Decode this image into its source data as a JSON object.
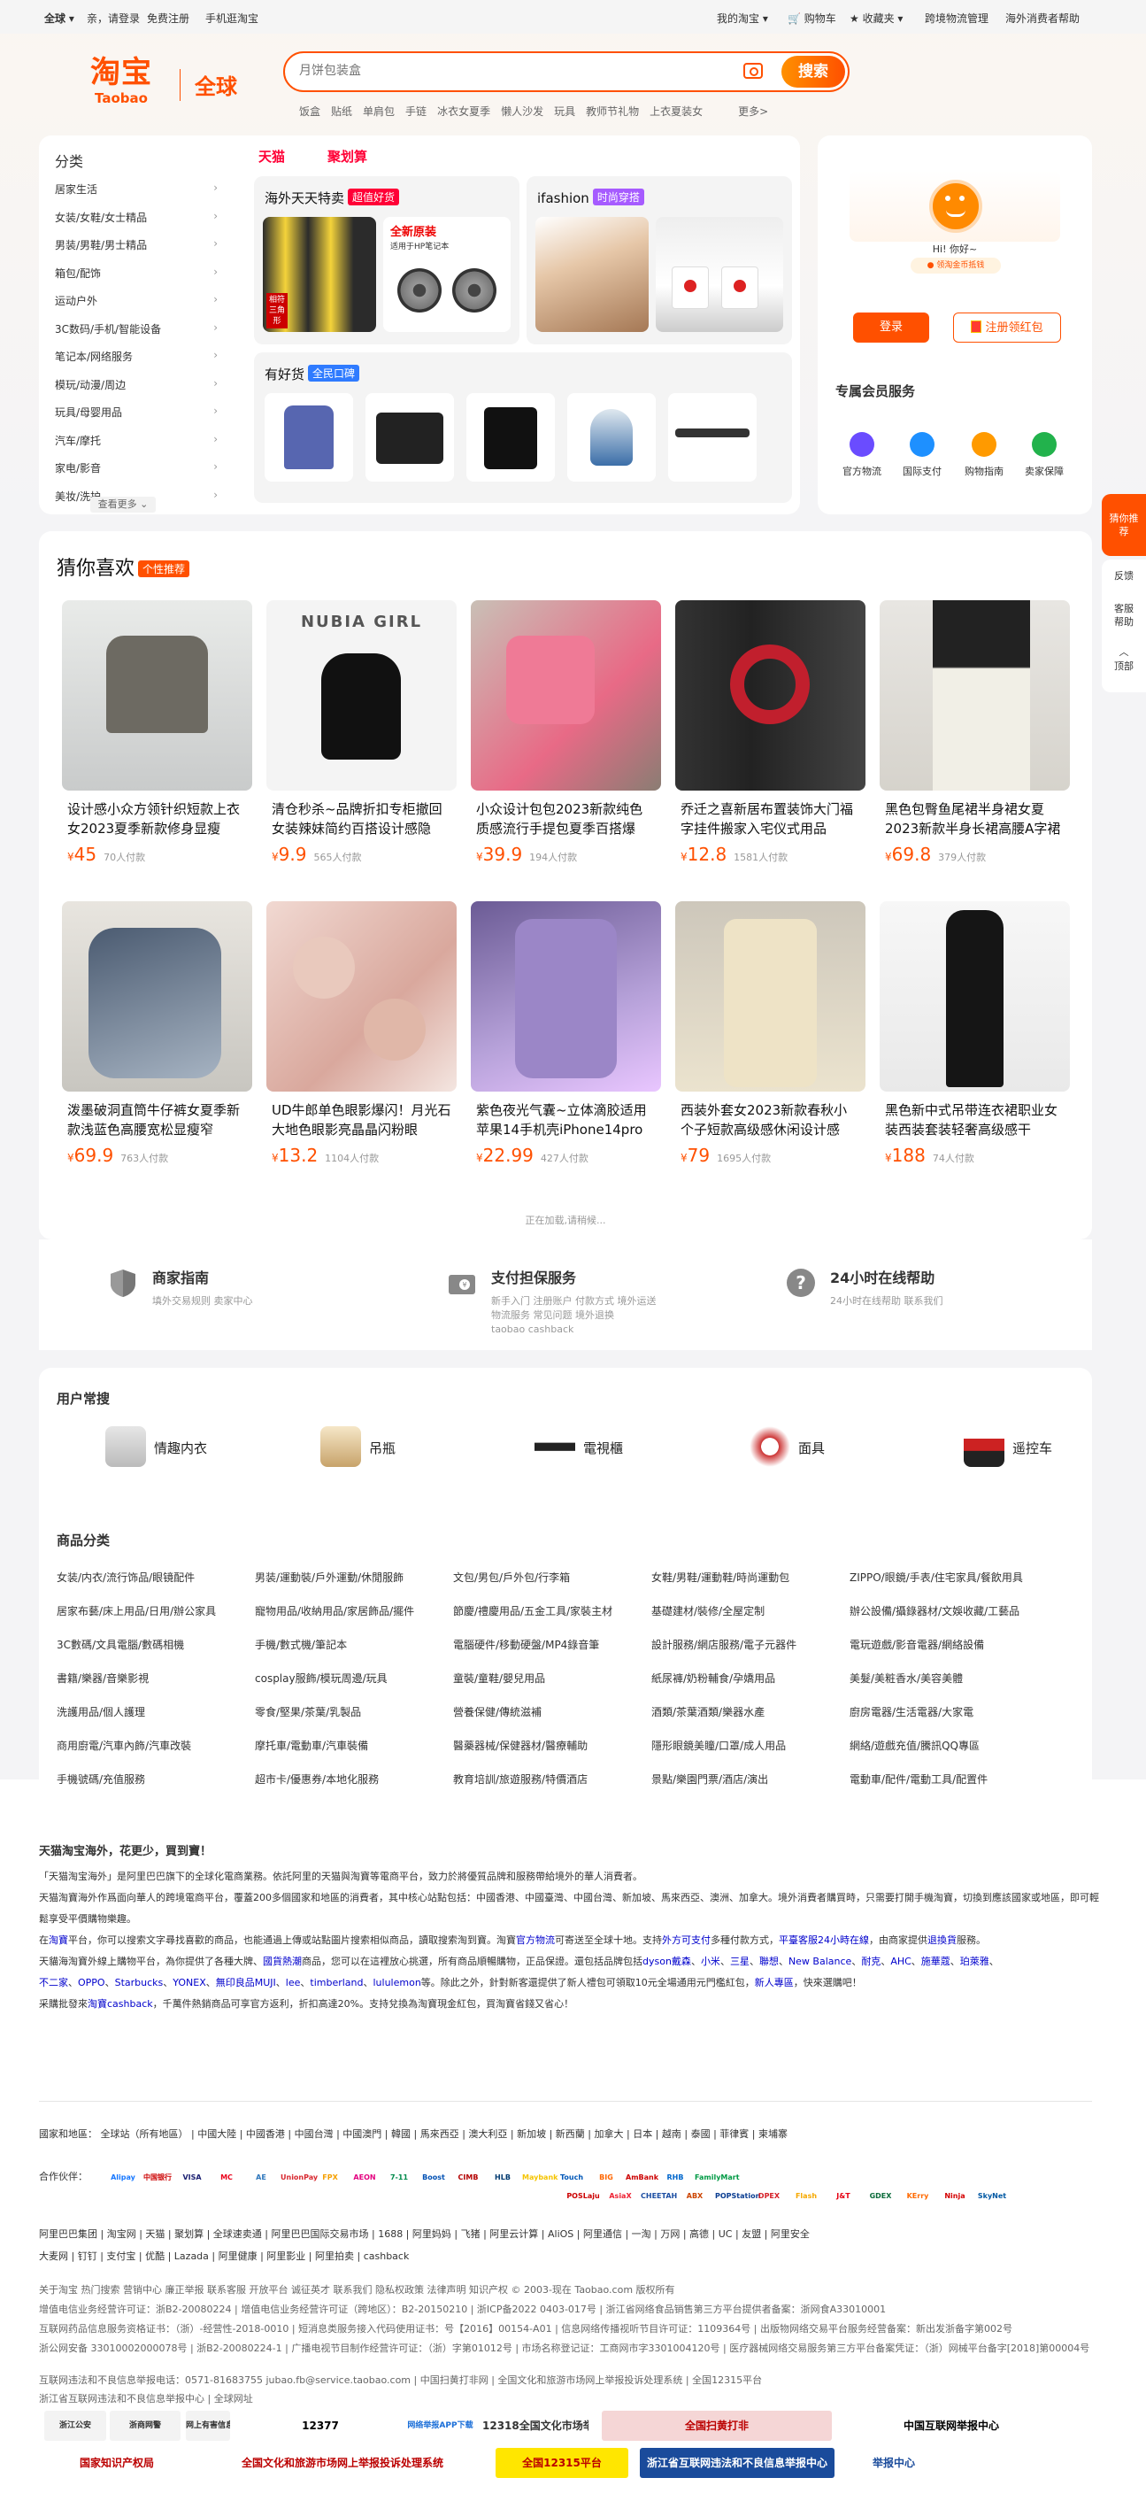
{
  "topbar": {
    "region": "全球",
    "greet": "亲，请登录",
    "register": "免费注册",
    "mobile": "手机逛淘宝",
    "mytaobao": "我的淘宝",
    "cart": "购物车",
    "favorites": "收藏夹",
    "crossborder": "跨境物流管理",
    "help": "海外消费者帮助"
  },
  "logo": {
    "cn": "淘宝",
    "en": "Taobao",
    "global": "全球"
  },
  "search": {
    "placeholder": "月饼包装盒",
    "button": "搜索",
    "hot": [
      "饭盒",
      "贴纸",
      "单肩包",
      "手链",
      "冰衣女夏季",
      "懒人沙发",
      "玩具",
      "教师节礼物",
      "上衣夏装女",
      "更多>"
    ]
  },
  "categories": {
    "title": "分类",
    "items": [
      "居家生活",
      "女装/女鞋/女士精品",
      "男装/男鞋/男士精品",
      "箱包/配饰",
      "运动户外",
      "3C数码/手机/智能设备",
      "笔记本/网络服务",
      "模玩/动漫/周边",
      "玩具/母婴用品",
      "汽车/摩托",
      "家电/影音",
      "美妆/洗护"
    ],
    "more": "查看更多"
  },
  "promo": {
    "tab1": "天猫",
    "tab2": "聚划算",
    "box1_title": "海外天天特卖",
    "box1_badge": "超值好货",
    "box1_img_text": "全新原装",
    "box1_img_sub": "适用于HP笔记本",
    "box1_img_side": "相符 三角形",
    "box2_title": "ifashion",
    "box2_badge": "时尚穿搭",
    "box3_title": "有好货",
    "box3_badge": "全民口碑"
  },
  "user": {
    "hello": "Hi! 你好~",
    "coin": "领淘金币抵钱",
    "login": "登录",
    "coupon": "注册领红包",
    "services_title": "专属会员服务",
    "services": [
      "官方物流",
      "国际支付",
      "购物指南",
      "卖家保障"
    ]
  },
  "sidefloat": {
    "recommend": "猜你推荐",
    "feedback": "反馈",
    "service": "客服帮助",
    "top": "顶部"
  },
  "guess": {
    "title": "猜你喜欢",
    "badge": "个性推荐",
    "loading": "正在加载,请稍候...",
    "products": [
      {
        "name": "设计感小众方领针织短款上衣女2023夏季新款修身显瘦",
        "price": "45",
        "sold": "70人付款"
      },
      {
        "name": "清仓秒杀~品牌折扣专柜撤回女装辣妹简约百搭设计感隐",
        "price": "9.9",
        "sold": "565人付款",
        "img_text": "NUBIA GIRL"
      },
      {
        "name": "小众设计包包2023新款纯色质感流行手提包夏季百搭爆",
        "price": "39.9",
        "sold": "194人付款"
      },
      {
        "name": "乔迁之喜新居布置装饰大门福字挂件搬家入宅仪式用品",
        "price": "12.8",
        "sold": "1581人付款"
      },
      {
        "name": "黑色包臀鱼尾裙半身裙女夏2023新款半身长裙高腰A字裙",
        "price": "69.8",
        "sold": "379人付款"
      },
      {
        "name": "泼墨破洞直筒牛仔裤女夏季新款浅蓝色高腰宽松显瘦窄",
        "price": "69.9",
        "sold": "763人付款"
      },
      {
        "name": "UD牛郎单色眼影爆闪！月光石大地色眼影亮晶晶闪粉眼",
        "price": "13.2",
        "sold": "1104人付款"
      },
      {
        "name": "紫色夜光气囊~立体滴胶适用苹果14手机壳iPhone14pro可",
        "price": "22.99",
        "sold": "427人付款"
      },
      {
        "name": "西装外套女2023新款春秋小个子短款高级感休闲设计感",
        "price": "79",
        "sold": "1695人付款"
      },
      {
        "name": "黑色新中式吊带连衣裙职业女装西装套装轻奢高级感干",
        "price": "188",
        "sold": "74人付款"
      }
    ]
  },
  "guide": [
    {
      "title": "商家指南",
      "sub": "填外交易规则  卖家中心"
    },
    {
      "title": "支付担保服务",
      "sub": "新手入门  注册账户  付款方式  境外运送\n物流服务  常见问题  境外退换\ntaobao cashback"
    },
    {
      "title": "24小时在线帮助",
      "sub": "24小时在线帮助  联系我们"
    }
  ],
  "usual": {
    "title": "用户常搜",
    "items": [
      "情趣内衣",
      "吊瓶",
      "電視櫃",
      "面具",
      "遥控车"
    ],
    "cat_title": "商品分类",
    "cats": [
      [
        "女装/内衣/流行饰品/眼镜配件",
        "男装/運動裝/戶外運動/休閒服飾",
        "文包/男包/戶外包/行李箱",
        "女鞋/男鞋/運動鞋/時尚運動包",
        "ZIPPO/眼鏡/手表/住宅家具/餐飲用具"
      ],
      [
        "居家布藝/床上用品/日用/辦公家具",
        "寵物用品/收納用品/家居飾品/擺件",
        "節慶/禮慶用品/五金工具/家裝主材",
        "基礎建材/裝修/全屋定制",
        "辦公設備/攝錄器材/文娛收藏/工藝品"
      ],
      [
        "3C數碼/文具電腦/數碼相機",
        "手機/數式機/筆記本",
        "電腦硬件/移動硬盤/MP4錄音筆",
        "設計服務/網店服務/電子元器件",
        "電玩遊戲/影音電器/網絡設備"
      ],
      [
        "書籍/樂器/音樂影視",
        "cosplay服飾/模玩周邊/玩具",
        "童裝/童鞋/嬰兒用品",
        "紙尿褲/奶粉輔食/孕嬌用品",
        "美髮/美粧香水/美容美體"
      ],
      [
        "洗護用品/個人護理",
        "零食/堅果/茶葉/乳製品",
        "營養保健/傳統滋補",
        "酒類/茶葉酒類/樂器水產",
        "廚房電器/生活電器/大家電"
      ],
      [
        "商用廚電/汽車內飾/汽車改裝",
        "摩托車/電動車/汽車裝備",
        "醫藥器械/保健器材/醫療輔助",
        "隱形眼鏡美瞳/口罩/成人用品",
        "網絡/遊戲充值/騰訊QQ專區"
      ],
      [
        "手機號碼/充值服務",
        "超市卡/優惠券/本地化服務",
        "教育培訓/旅遊服務/特價酒店",
        "景點/樂園門票/酒店/演出",
        "電動車/配件/電動工具/配置件"
      ]
    ]
  },
  "about": {
    "heading": "天猫淘宝海外，花更少，買到寶！",
    "p1": "「天猫淘宝海外」是阿里巴巴旗下的全球化電商業務。依託阿里的天猫與淘寶等電商平台，致力於將優質品牌和服務帶給境外的華人消費者。",
    "p2": "天猫淘寶海外作爲面向華人的跨境電商平台，覆蓋200多個國家和地區的消費者，其中核心站點包括：中國香港、中國臺灣、中國台灣、新加坡、馬來西亞、澳洲、加拿大。境外消費者購買時，只需要打開手機淘寶，切換到應該國家或地區，即可輕鬆享受平價購物樂趣。",
    "p3a": "在",
    "p3b": "淘寶",
    "p3c": "平台，你可以搜索文字尋找喜歡的商品，也能通過上傳或站點圖片搜索相似商品，讀取搜索淘到寶。淘寶",
    "p3d": "官方物流",
    "p3e": "可寄送至全球十地。支持",
    "p3f": "外方可支付",
    "p3g": "多種付款方式，",
    "p3h": "平臺客服24小時在線",
    "p3i": "，由商家提供",
    "p3j": "退換貨",
    "p3k": "服務。",
    "p4a": "天貓海淘寶外線上購物平台，為你提供了各種大牌、",
    "p4b": "國貨熱潮",
    "p4c": "商品，您可以在這裡放心挑選，所有商品順暢購物，正品保證。還包括品牌包括",
    "p4d": "dyson戴森",
    "p4e": "、",
    "p4f": "小米",
    "p4g": "、",
    "p4h": "三星",
    "p4i": "、",
    "p4j": "聯想",
    "p4k": "、",
    "p4l": "New Balance",
    "p4m": "、",
    "p4n": "耐克",
    "p4o": "、",
    "p4p": "AHC",
    "p4q": "、",
    "p4r": "施華蔻",
    "p4s": "、",
    "p4t": "珀萊雅",
    "p4u": "、",
    "p5a": "不二家",
    "p5b": "、",
    "p5c": "OPPO",
    "p5d": "、",
    "p5e": "Starbucks",
    "p5f": "、",
    "p5g": "YONEX",
    "p5h": "、",
    "p5i": "無印良品MUJI",
    "p5j": "、",
    "p5k": "lee",
    "p5l": "、",
    "p5m": "timberland",
    "p5n": "、",
    "p5o": "lululemon",
    "p5p": "等。除此之外，針對新客還提供了新人禮包可領取10元全場通用元門檻紅包，",
    "p5q": "新人專區",
    "p5r": "，快來選購吧！",
    "p6a": "采購批發來",
    "p6b": "淘寶cashback",
    "p6c": "，千萬件熱銷商品可享官方返利，折扣高達20%。支持兌換為淘寶現金紅包，買淘寶省錢又省心！"
  },
  "footer": {
    "region_label": "國家和地區：",
    "regions": "全球站（所有地區） | 中國大陸 | 中國香港 | 中國台灣 | 中國澳門 | 韓國 | 馬來西亞 | 澳大利亞 | 新加坡 | 新西蘭 | 加拿大 | 日本 | 越南 | 泰國 | 菲律賓 | 柬埔寨",
    "partners_label": "合作伙伴：",
    "links1": "阿里巴巴集团  |  淘宝网  |  天猫  |  聚划算  |  全球速卖通  |  阿里巴巴国际交易市场  |  1688  |  阿里妈妈  |  飞猪  |  阿里云计算  |  AliOS  |  阿里通信  |  一淘  |  万网  |  高德  |  UC  |  友盟  |  阿里安全",
    "links1b": "大麦网  |  钉钉  |  支付宝  |  优酷  |  Lazada  |  阿里健康  |  阿里影业  |  阿里拍卖  |  cashback",
    "links2": "关于淘宝  热门搜索  营销中心  廉正举报  联系客服  开放平台  诚征英才  联系我们  隐私权政策  法律声明  知识产权  © 2003-现在 Taobao.com 版权所有",
    "license1": "增值电信业务经营许可证：浙B2-20080224  |  增值电信业务经营许可证（跨地区）：B2-20150210  |  浙ICP备2022 0403-017号  |  浙江省网络食品销售第三方平台提供者备案：浙网食A33010001",
    "license2": "互联网药品信息服务资格证书：（浙）-经营性-2018-0010  |  短消息类服务接入代码使用证书：号【2016】00154-A01  |  信息网络传播视听节目许可证：1109364号  |  出版物网络交易平台服务经营备案：新出发浙备字第002号",
    "license3": "浙公网安备 33010002000078号  |  浙B2-20080224-1  |  广播电视节目制作经营许可证：（浙）字第01012号  |  市场名称登记证：工商网市字3301004120号  |  医疗器械网络交易服务第三方平台备案凭证：（浙）网械平台备字[2018]第00004号",
    "license4": "互联网违法和不良信息举报电话：0571-81683755 jubao.fb@service.taobao.com  |  中国扫黄打非网  |  全国文化和旅游市场网上举报投诉处理系统  |  全国12315平台",
    "license5": "浙江省互联网违法和不良信息举报中心  |  全球网址",
    "partners": [
      "Alipay",
      "中国银行",
      "VISA",
      "MC",
      "AE",
      "UnionPay",
      "FPX",
      "AEON",
      "7-11",
      "Boost",
      "CIMB",
      "HLB",
      "Maybank",
      "Touch",
      "BIG",
      "AmBank",
      "RHB",
      "FamilyMart"
    ],
    "partners2": [
      "POSLaju",
      "AsiaX",
      "CHEETAH",
      "ABX",
      "POPStation",
      "DPEX",
      "Flash",
      "J&T",
      "GDEX",
      "KErry",
      "Ninja",
      "SkyNet"
    ],
    "badges": [
      "浙江公安",
      "浙商网警",
      "网上有害信息举报专区",
      "12377",
      "网络举报APP下载",
      "12318全国文化市场举报平台",
      "全国扫黄打非",
      "中国互联网举报中心",
      "国家知识产权局",
      "全国文化和旅游市场网上举报投诉处理系统",
      "全国12315平台",
      "浙江省互联网违法和不良信息举报中心",
      "举报中心"
    ]
  },
  "colors": {
    "accent": "#ff5000",
    "tmall": "#ff0036",
    "link": "#0000cc"
  }
}
